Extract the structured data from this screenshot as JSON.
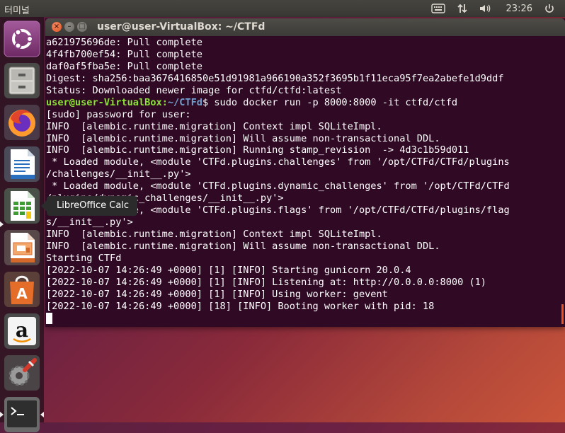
{
  "top_panel": {
    "app_title": "터미널",
    "clock": "23:26",
    "indicators": [
      "keyboard-icon",
      "network-icon",
      "volume-icon",
      "power-icon"
    ]
  },
  "launcher": {
    "items": [
      {
        "name": "ubuntu-dash",
        "icon": "ubuntu-logo-icon",
        "color": "#dd4814"
      },
      {
        "name": "files",
        "icon": "file-cabinet-icon",
        "color": "#8b8b8b"
      },
      {
        "name": "firefox",
        "icon": "firefox-icon",
        "color": "#e66000"
      },
      {
        "name": "libreoffice-writer",
        "icon": "writer-icon",
        "color": "#2a6fbd"
      },
      {
        "name": "libreoffice-calc",
        "icon": "calc-icon",
        "color": "#3f9c35"
      },
      {
        "name": "libreoffice-impress",
        "icon": "impress-icon",
        "color": "#d4682b"
      },
      {
        "name": "ubuntu-software",
        "icon": "software-bag-icon",
        "color": "#e36d29"
      },
      {
        "name": "amazon",
        "icon": "amazon-icon",
        "color": "#f4f4f4"
      },
      {
        "name": "system-settings",
        "icon": "settings-tools-icon",
        "color": "#7a7a7a"
      },
      {
        "name": "terminal",
        "icon": "terminal-icon",
        "color": "#2e2e2e"
      }
    ],
    "tooltip": "LibreOffice Calc"
  },
  "window": {
    "title": "user@user-VirtualBox: ~/CTFd",
    "accent": "#e95420",
    "background": "#300a24"
  },
  "terminal": {
    "lines": [
      "a621975696de: Pull complete",
      "4f4fb700ef54: Pull complete",
      "daf0af5fba5e: Pull complete",
      "Digest: sha256:baa3676416850e51d91981a966190a352f3695b1f11eca95f7ea2abefe1d9ddf",
      "Status: Downloaded newer image for ctfd/ctfd:latest",
      "",
      "[sudo] password for user:",
      "INFO  [alembic.runtime.migration] Context impl SQLiteImpl.",
      "INFO  [alembic.runtime.migration] Will assume non-transactional DDL.",
      "INFO  [alembic.runtime.migration] Running stamp_revision  -> 4d3c1b59d011",
      " * Loaded module, <module 'CTFd.plugins.challenges' from '/opt/CTFd/CTFd/plugins",
      "/challenges/__init__.py'>",
      " * Loaded module, <module 'CTFd.plugins.dynamic_challenges' from '/opt/CTFd/CTFd",
      "/plugins/dynamic_challenges/__init__.py'>",
      " * Loaded module, <module 'CTFd.plugins.flags' from '/opt/CTFd/CTFd/plugins/flag",
      "s/__init__.py'>",
      "INFO  [alembic.runtime.migration] Context impl SQLiteImpl.",
      "INFO  [alembic.runtime.migration] Will assume non-transactional DDL.",
      "Starting CTFd",
      "[2022-10-07 14:26:49 +0000] [1] [INFO] Starting gunicorn 20.0.4",
      "[2022-10-07 14:26:49 +0000] [1] [INFO] Listening at: http://0.0.0.0:8000 (1)",
      "[2022-10-07 14:26:49 +0000] [1] [INFO] Using worker: gevent",
      "[2022-10-07 14:26:49 +0000] [18] [INFO] Booting worker with pid: 18"
    ],
    "prompt": {
      "user": "user@user-VirtualBox",
      "sep": ":",
      "path": "~/CTFd",
      "symbol": "$",
      "command": " sudo docker run -p 8000:8000 -it ctfd/ctfd"
    }
  }
}
